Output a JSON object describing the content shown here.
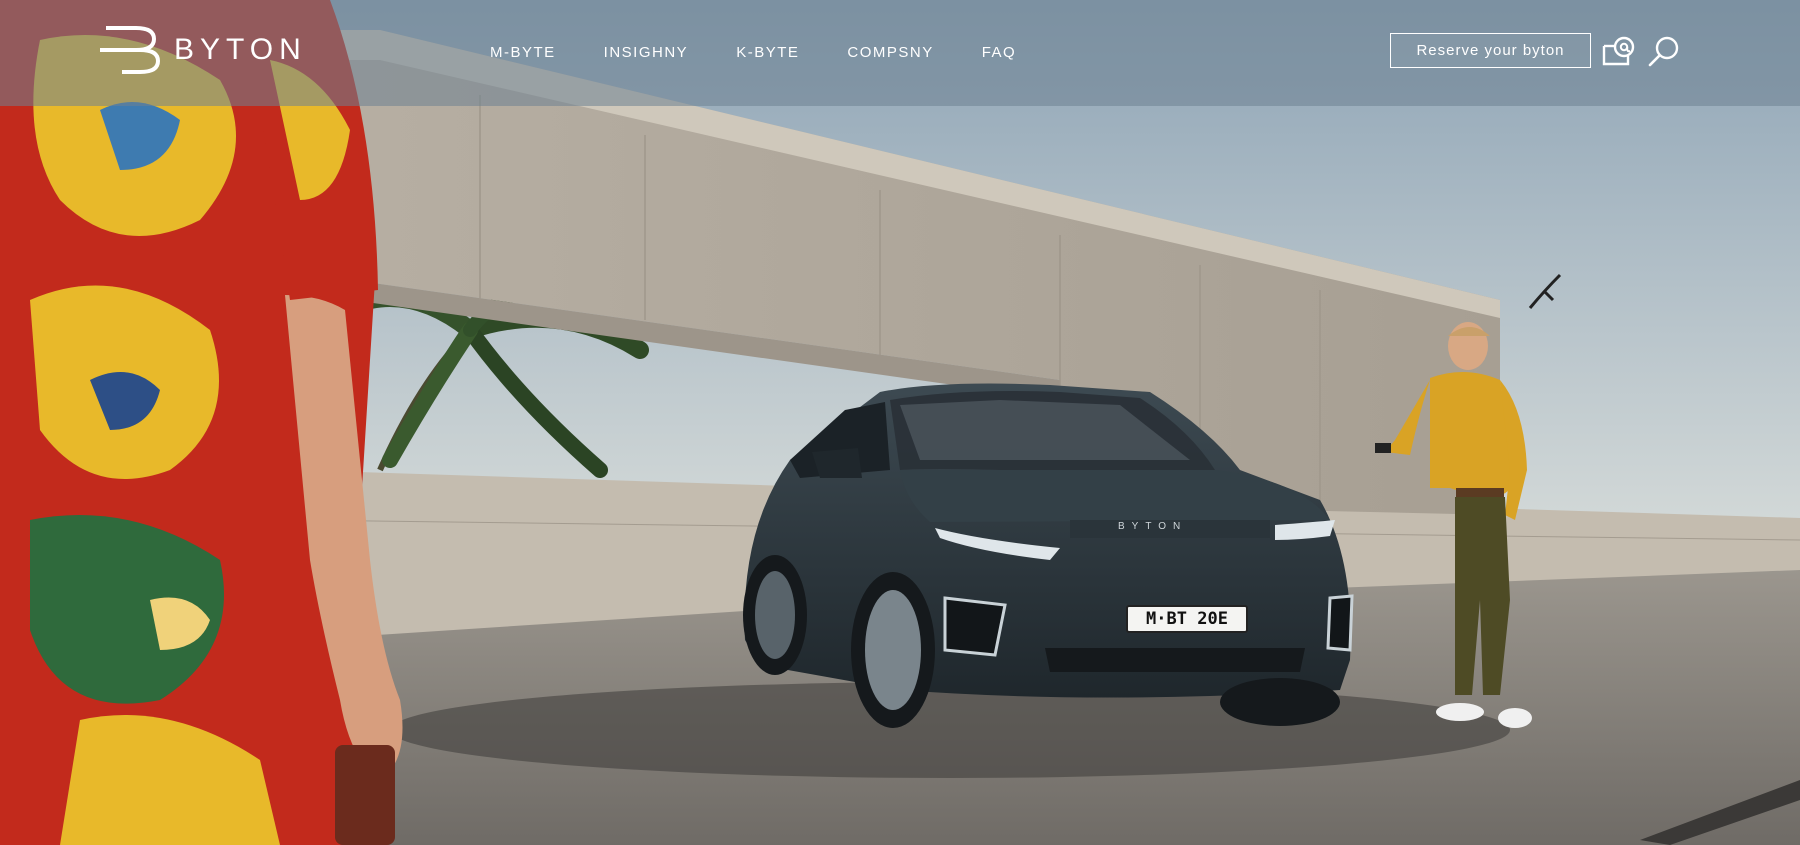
{
  "brand": {
    "name": "BYTON",
    "logo_icon": "byton-logo-icon"
  },
  "nav": {
    "items": [
      {
        "label": "M-BYTE"
      },
      {
        "label": "INSIGHNY"
      },
      {
        "label": "K-BYTE"
      },
      {
        "label": "COMPSNY"
      },
      {
        "label": "FAQ"
      }
    ]
  },
  "header": {
    "reserve_label": "Reserve your byton",
    "contact_icon": "mail-at-icon",
    "search_icon": "search-icon"
  },
  "hero": {
    "car_badge": "BYTON",
    "license_plate": "M·BT 20E"
  },
  "colors": {
    "nav_overlay": "#6e8291",
    "sky": "#b9c8d2",
    "concrete": "#bdb5a8",
    "car_body": "#2f3a40",
    "ground": "#7c7975",
    "dress_red": "#c22a1c",
    "dress_yellow": "#e8b92a",
    "sweater_mustard": "#d9a325"
  }
}
